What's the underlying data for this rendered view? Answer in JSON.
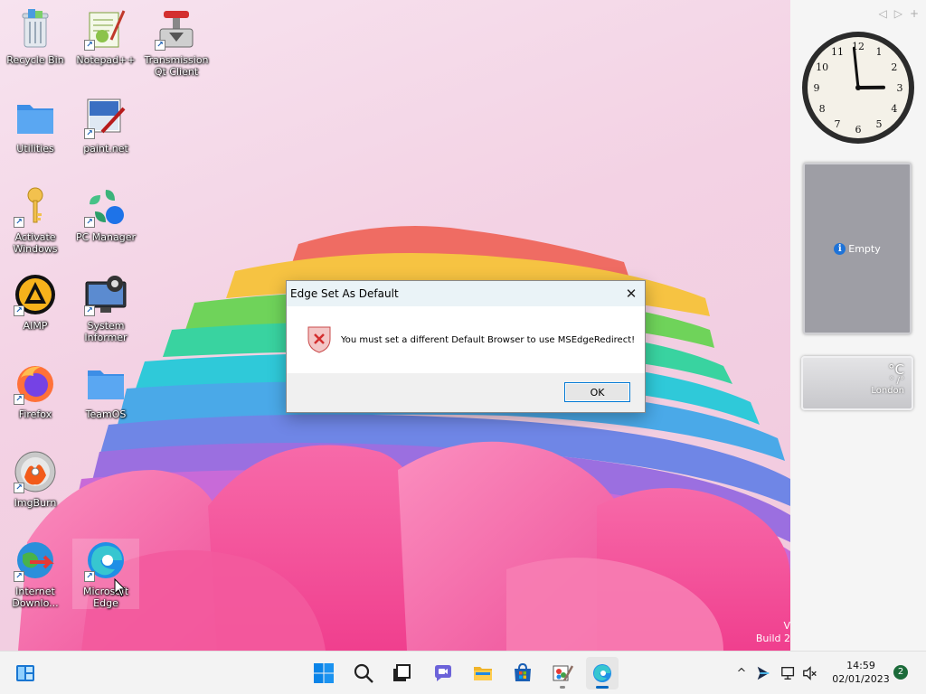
{
  "desktop": {
    "icons": [
      {
        "label": "Recycle Bin"
      },
      {
        "label": "Notepad++"
      },
      {
        "label": "Transmission Qt Client"
      },
      {
        "label": "Utilities"
      },
      {
        "label": "paint.net"
      },
      {
        "label": "Activate Windows"
      },
      {
        "label": "PC Manager"
      },
      {
        "label": "AIMP"
      },
      {
        "label": "System Informer"
      },
      {
        "label": "Firefox"
      },
      {
        "label": "TeamOS"
      },
      {
        "label": "ImgBurn"
      },
      {
        "label": "Internet Downlo..."
      },
      {
        "label": "Microsoft Edge"
      }
    ]
  },
  "gadgets": {
    "clock": {
      "hour": 2,
      "minute": 59,
      "numbers": [
        "12",
        "1",
        "2",
        "3",
        "4",
        "5",
        "6",
        "7",
        "8",
        "9",
        "10",
        "11"
      ]
    },
    "slideshow": {
      "empty_label": "Empty"
    },
    "weather": {
      "temp": "°C",
      "hilo": "° /°",
      "city": "London"
    },
    "nav": {
      "prev": "◁",
      "next": "▷",
      "add": "+"
    }
  },
  "watermark": {
    "line1": "V",
    "line2": "Build 2"
  },
  "dialog": {
    "title": "Edge Set As Default",
    "close": "✕",
    "message": "You must set a different Default Browser to use MSEdgeRedirect!",
    "ok_label": "OK"
  },
  "taskbar": {
    "apps": [
      "start",
      "search",
      "task-view",
      "chat",
      "file-explorer",
      "microsoft-store",
      "paint-net",
      "microsoft-edge"
    ],
    "clock_time": "14:59",
    "clock_date": "02/01/2023",
    "notifications": "2",
    "chevron": "^"
  },
  "colors": {
    "accent": "#0078d4",
    "edge_active_indicator": "#0067c0",
    "dialog_title_bg": "#eaf3f7"
  }
}
